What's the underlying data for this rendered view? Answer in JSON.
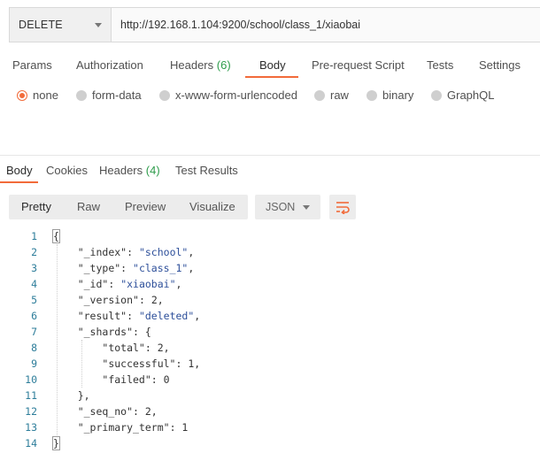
{
  "request": {
    "method": "DELETE",
    "url": "http://192.168.1.104:9200/school/class_1/xiaobai"
  },
  "request_tabs": [
    {
      "label": "Params"
    },
    {
      "label": "Authorization"
    },
    {
      "label": "Headers",
      "count": "(6)"
    },
    {
      "label": "Body",
      "active": true
    },
    {
      "label": "Pre-request Script"
    },
    {
      "label": "Tests"
    },
    {
      "label": "Settings"
    }
  ],
  "body_types": [
    {
      "label": "none",
      "selected": true
    },
    {
      "label": "form-data"
    },
    {
      "label": "x-www-form-urlencoded"
    },
    {
      "label": "raw"
    },
    {
      "label": "binary"
    },
    {
      "label": "GraphQL"
    }
  ],
  "response_tabs": [
    {
      "label": "Body",
      "active": true
    },
    {
      "label": "Cookies"
    },
    {
      "label": "Headers",
      "count": "(4)"
    },
    {
      "label": "Test Results"
    }
  ],
  "view_modes": [
    {
      "label": "Pretty",
      "active": true
    },
    {
      "label": "Raw"
    },
    {
      "label": "Preview"
    },
    {
      "label": "Visualize"
    }
  ],
  "format": "JSON",
  "colors": {
    "accent": "#f26b3a",
    "count": "#2e9c4b",
    "line_number": "#2d7d9a",
    "string": "#2d4f9a"
  },
  "icons": {
    "format_chevron": "chevron-down-icon",
    "method_chevron": "chevron-down-icon",
    "wrap": "wrap-lines-icon"
  },
  "code_lines": [
    {
      "n": "1",
      "text": "{"
    },
    {
      "n": "2",
      "text": "    \"_index\": \"school\","
    },
    {
      "n": "3",
      "text": "    \"_type\": \"class_1\","
    },
    {
      "n": "4",
      "text": "    \"_id\": \"xiaobai\","
    },
    {
      "n": "5",
      "text": "    \"_version\": 2,"
    },
    {
      "n": "6",
      "text": "    \"result\": \"deleted\","
    },
    {
      "n": "7",
      "text": "    \"_shards\": {"
    },
    {
      "n": "8",
      "text": "        \"total\": 2,"
    },
    {
      "n": "9",
      "text": "        \"successful\": 1,"
    },
    {
      "n": "10",
      "text": "        \"failed\": 0"
    },
    {
      "n": "11",
      "text": "    },"
    },
    {
      "n": "12",
      "text": "    \"_seq_no\": 2,"
    },
    {
      "n": "13",
      "text": "    \"_primary_term\": 1"
    },
    {
      "n": "14",
      "text": "}"
    }
  ]
}
